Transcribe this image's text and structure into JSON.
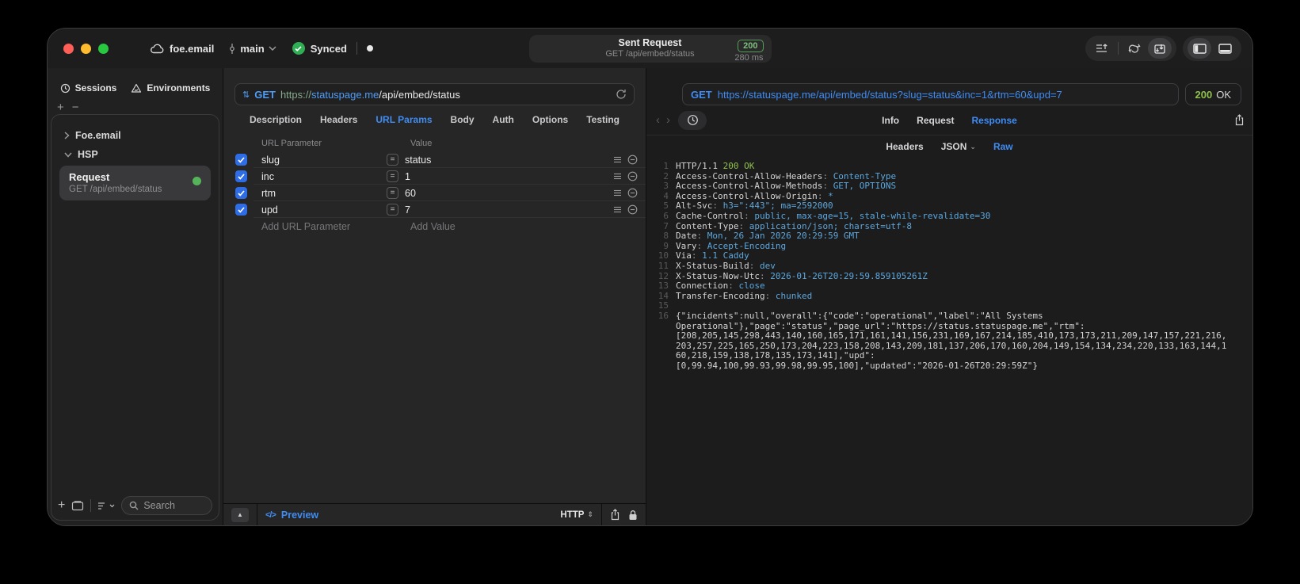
{
  "titlebar": {
    "project": "foe.email",
    "branch": "main",
    "sync_status": "Synced",
    "request_title": "Sent Request",
    "request_subtitle": "GET /api/embed/status",
    "status_code": "200",
    "duration": "280 ms",
    "status_color": "#7ec07f"
  },
  "sidebar": {
    "tabs": [
      {
        "label": "Sessions",
        "active": true
      },
      {
        "label": "Environments",
        "active": false
      }
    ],
    "tree": [
      {
        "label": "Foe.email",
        "expanded": false
      },
      {
        "label": "HSP",
        "expanded": true
      }
    ],
    "selected_request": {
      "name": "Request",
      "method_path": "GET /api/embed/status"
    },
    "search_placeholder": "Search"
  },
  "request_editor": {
    "method": "GET",
    "url_scheme": "https://",
    "url_host": "statuspage.me",
    "url_path": "/api/embed/status",
    "tabs": [
      {
        "label": "Description",
        "active": false
      },
      {
        "label": "Headers",
        "active": false
      },
      {
        "label": "URL Params",
        "active": true
      },
      {
        "label": "Body",
        "active": false
      },
      {
        "label": "Auth",
        "active": false
      },
      {
        "label": "Options",
        "active": false
      },
      {
        "label": "Testing",
        "active": false
      }
    ],
    "params": {
      "col_name": "URL Parameter",
      "col_value": "Value",
      "rows": [
        {
          "name": "slug",
          "value": "status",
          "checked": true
        },
        {
          "name": "inc",
          "value": "1",
          "checked": true
        },
        {
          "name": "rtm",
          "value": "60",
          "checked": true
        },
        {
          "name": "upd",
          "value": "7",
          "checked": true
        }
      ],
      "add_name": "Add URL Parameter",
      "add_value": "Add Value"
    },
    "footer": {
      "preview_label": "Preview",
      "protocol": "HTTP"
    }
  },
  "response_viewer": {
    "method": "GET",
    "url": "https://statuspage.me/api/embed/status?slug=status&inc=1&rtm=60&upd=7",
    "status_code": "200",
    "status_text": "OK",
    "tabs": [
      {
        "label": "Info",
        "active": false
      },
      {
        "label": "Request",
        "active": false
      },
      {
        "label": "Response",
        "active": true
      }
    ],
    "subtabs": [
      {
        "label": "Headers",
        "active": false,
        "dropdown": false
      },
      {
        "label": "JSON",
        "active": false,
        "dropdown": true
      },
      {
        "label": "Raw",
        "active": true,
        "dropdown": false
      }
    ],
    "http_line": {
      "protocol": "HTTP/1.1",
      "status": "200 OK"
    },
    "headers": [
      {
        "name": "Access-Control-Allow-Headers",
        "value": "Content-Type"
      },
      {
        "name": "Access-Control-Allow-Methods",
        "value": "GET, OPTIONS"
      },
      {
        "name": "Access-Control-Allow-Origin",
        "value": "*"
      },
      {
        "name": "Alt-Svc",
        "value": "h3=\":443\"; ma=2592000"
      },
      {
        "name": "Cache-Control",
        "value": "public, max-age=15, stale-while-revalidate=30"
      },
      {
        "name": "Content-Type",
        "value": "application/json; charset=utf-8"
      },
      {
        "name": "Date",
        "value": "Mon, 26 Jan 2026 20:29:59 GMT"
      },
      {
        "name": "Vary",
        "value": "Accept-Encoding"
      },
      {
        "name": "Via",
        "value": "1.1 Caddy"
      },
      {
        "name": "X-Status-Build",
        "value": "dev"
      },
      {
        "name": "X-Status-Now-Utc",
        "value": "2026-01-26T20:29:59.859105261Z"
      },
      {
        "name": "Connection",
        "value": "close"
      },
      {
        "name": "Transfer-Encoding",
        "value": "chunked"
      }
    ],
    "body_lines": [
      "{\"incidents\":null,\"overall\":{\"code\":\"operational\",\"label\":\"All Systems",
      "Operational\"},\"page\":\"status\",\"page_url\":\"https://status.statuspage.me\",\"rtm\":",
      "[208,205,145,298,443,140,160,165,171,161,141,156,231,169,167,214,185,410,173,173,211,209,147,157,221,216,",
      "203,257,225,165,250,173,204,223,158,208,143,209,181,137,206,170,160,204,149,154,134,234,220,133,163,144,1",
      "60,218,159,138,178,135,173,141],\"upd\":",
      "[0,99.94,100,99.93,99.98,99.95,100],\"updated\":\"2026-01-26T20:29:59Z\"}"
    ]
  }
}
